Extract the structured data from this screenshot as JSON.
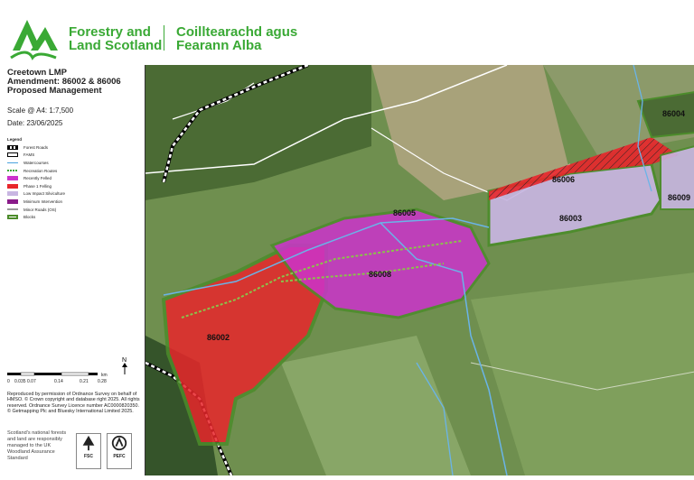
{
  "header": {
    "org_en_line1": "Forestry and",
    "org_en_line2": "Land Scotland",
    "org_gd_line1": "Coilltearachd agus",
    "org_gd_line2": "Fearann Alba",
    "brand_color": "#3aa935"
  },
  "sidebar": {
    "title_line1": "Creetown LMP",
    "title_line2": "Amendment: 86002 & 86006",
    "title_line3": "Proposed Management",
    "scale": "Scale @ A4: 1:7,500",
    "date": "Date: 23/06/2025",
    "legend_title": "Legend",
    "legend": [
      {
        "label": "Forest Roads",
        "color": "#000000"
      },
      {
        "label": "FAMS",
        "color": "#000000"
      },
      {
        "label": "Watercourses",
        "color": "#4aa3df"
      },
      {
        "label": "Recreation Routes",
        "color": "#3aa935"
      },
      {
        "label": "Recently Felled",
        "color": "#cc33cc"
      },
      {
        "label": "Phase 1 Felling",
        "color": "#e8262b"
      },
      {
        "label": "Low Impact Silviculture",
        "color": "#c8b6e2"
      },
      {
        "label": "Minimum Intervention",
        "color": "#8a1c8a"
      },
      {
        "label": "Minor Roads (OS)",
        "color": "#9a9a9a"
      },
      {
        "label": "Blocks",
        "color": "#4c8c2b"
      }
    ],
    "scalebar_unit": "km",
    "scalebar_ticks": [
      "0",
      "0.035",
      "0.07",
      "0.14",
      "0.21",
      "0.28"
    ],
    "north_label": "N",
    "credits": "Reproduced by permission of Ordnance Survey on behalf of HMSO. © Crown copyright and database right 2025. All rights reserved. Ordnance Survey Licence number AC0000820350. © Getmapping Plc and Bluesky International Limited 2025.",
    "statement": "Scotland's national forests and land are responsibly managed to the UK Woodland Assurance Standard",
    "cert1": "FSC",
    "cert2": "PEFC"
  },
  "map": {
    "block_labels": [
      "86005",
      "86008",
      "86002",
      "86006",
      "86003",
      "86004",
      "86009"
    ]
  }
}
